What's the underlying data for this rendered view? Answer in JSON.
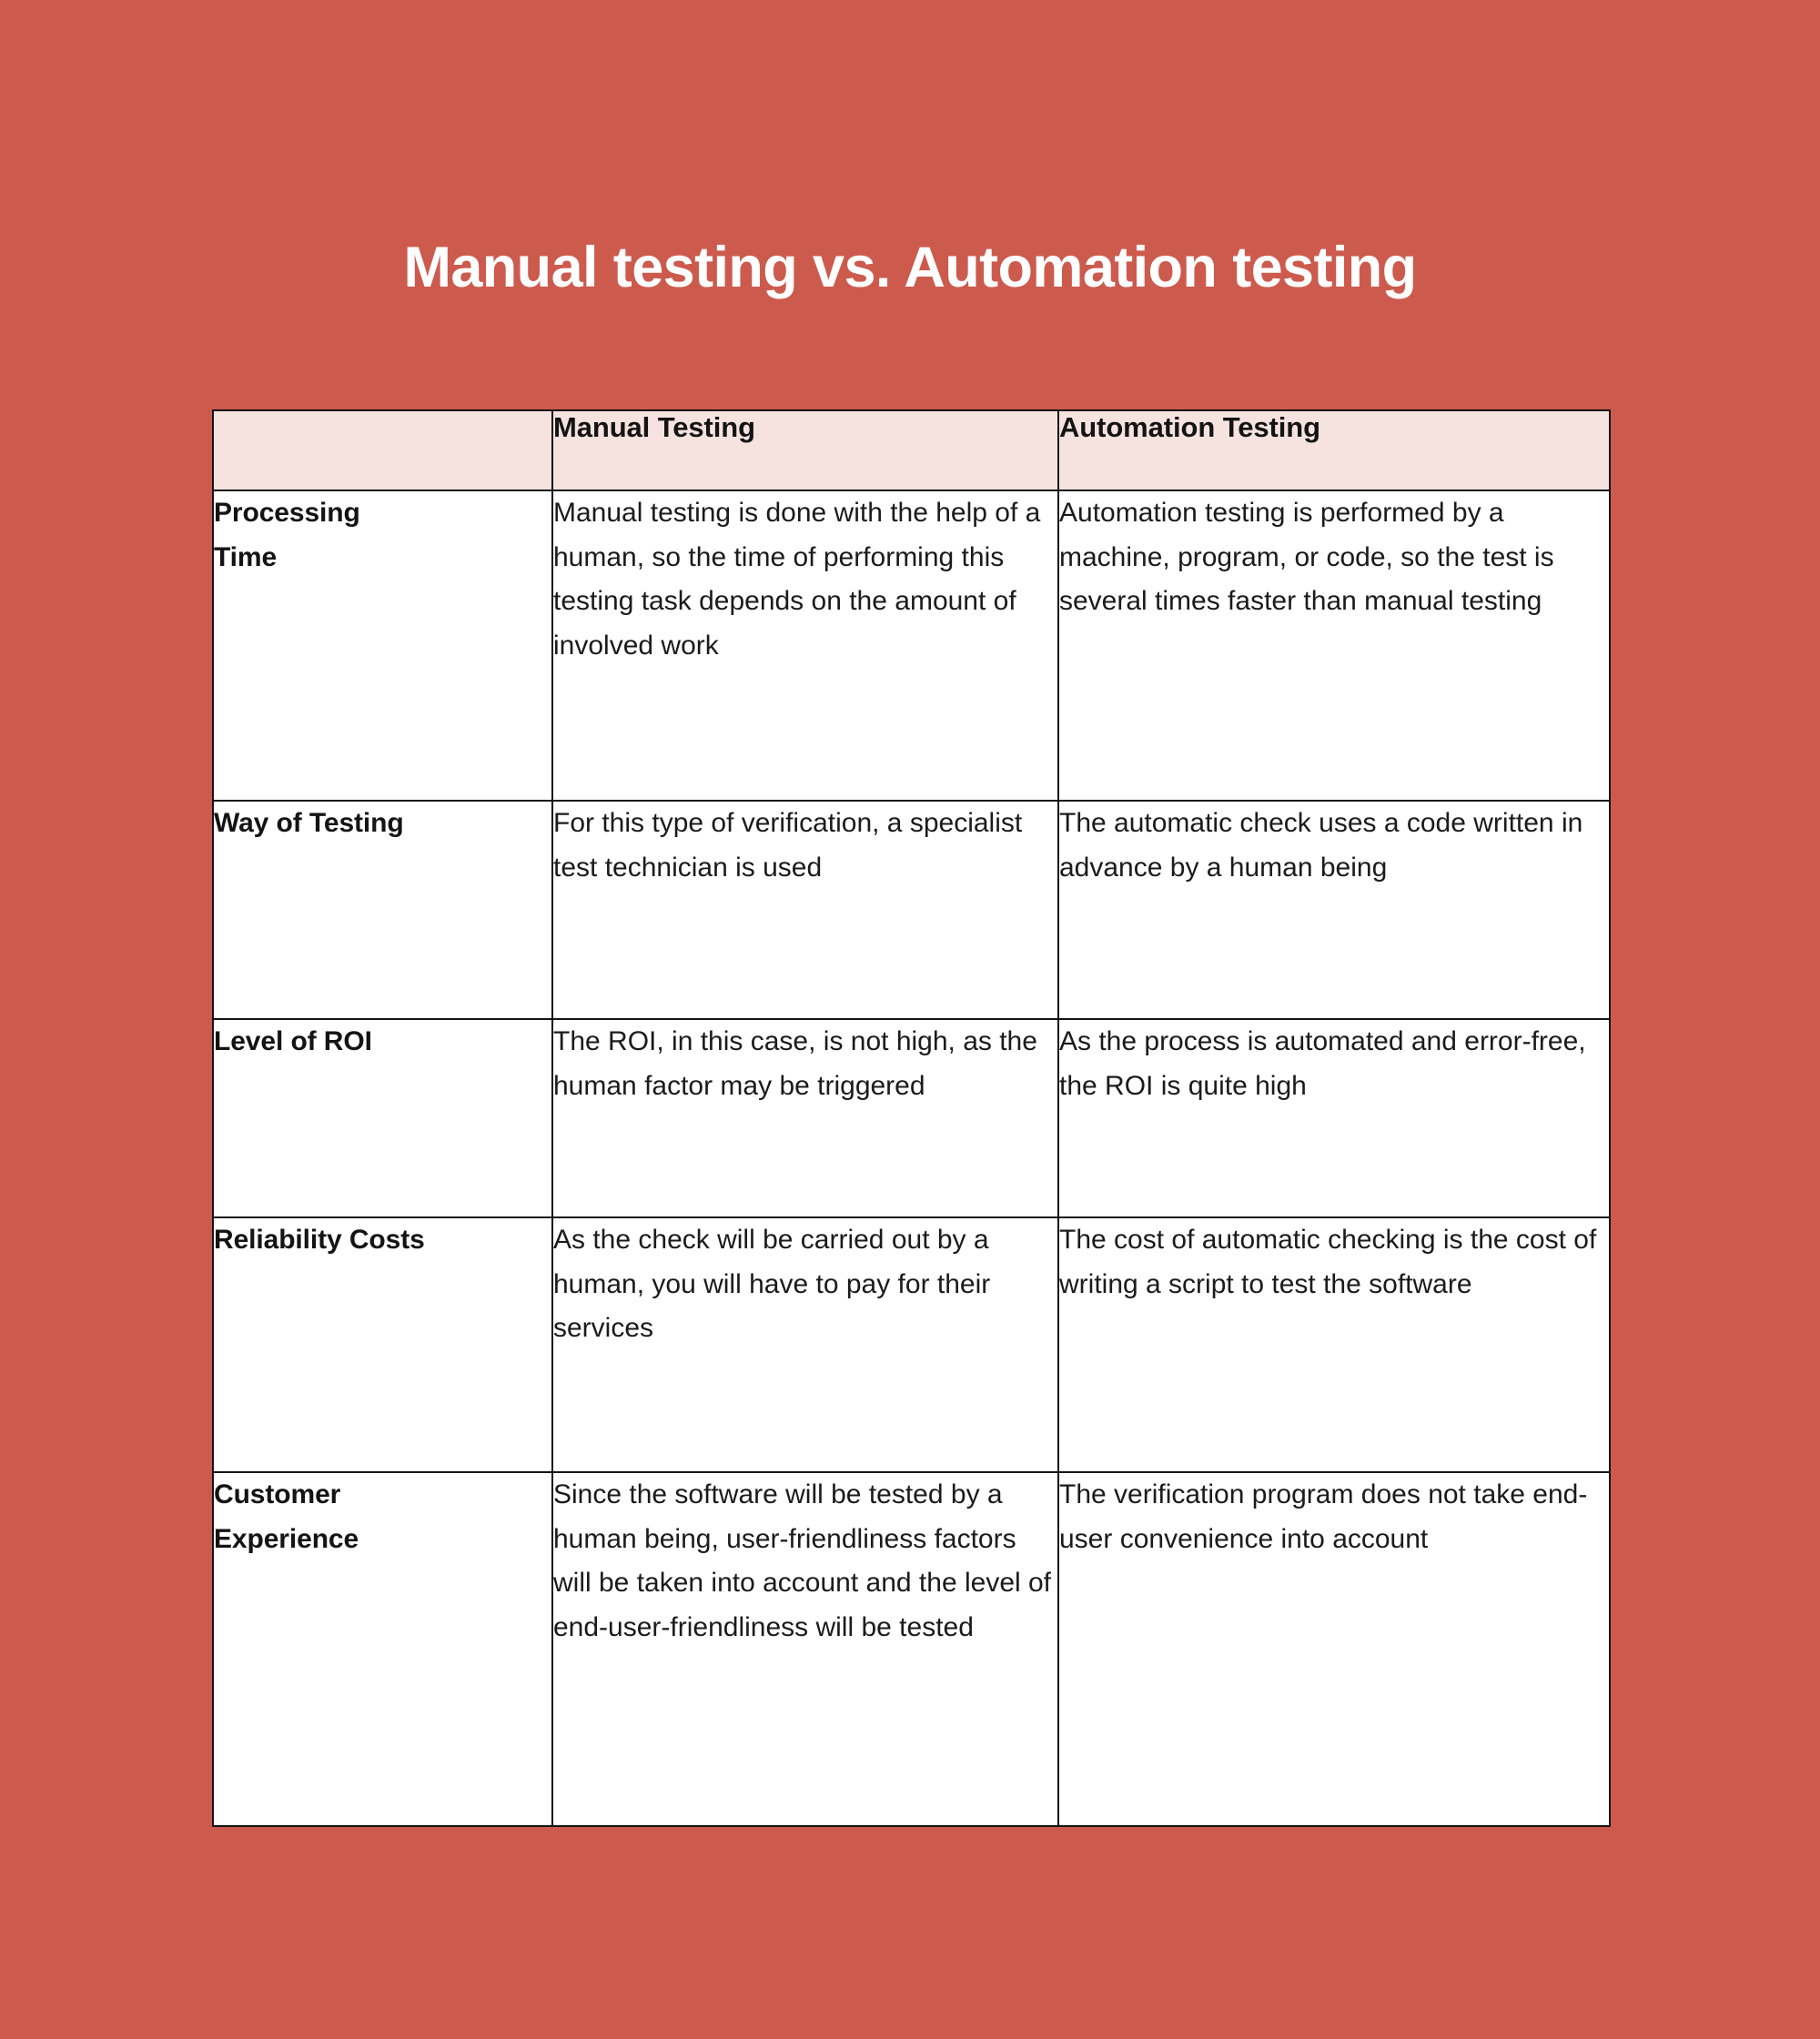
{
  "theme": {
    "background": "#cc5b4e",
    "header_fill": "#f6e3e0",
    "border": "#141414",
    "title_color": "#ffffff",
    "body_text": "#1b1b1b"
  },
  "title": "Manual testing vs. Automation testing",
  "table": {
    "columns": [
      {
        "key": "criteria",
        "label": ""
      },
      {
        "key": "manual",
        "label": "Manual Testing"
      },
      {
        "key": "automation",
        "label": "Automation Testing"
      }
    ],
    "rows": [
      {
        "label": "Processing\nTime",
        "manual": "Manual testing is done with the help of a human, so the time of performing this testing task depends on the amount of involved work",
        "automation": "Automation testing is performed by a machine, program, or code, so the test is several times faster than manual testing"
      },
      {
        "label": "Way of Testing",
        "manual": "For this type of verification, a specialist test technician is used",
        "automation": "The automatic check uses a code written in advance by a human being"
      },
      {
        "label": "Level of ROI",
        "manual": "The ROI, in this case, is not high, as the human factor may be triggered",
        "automation": "As the process is automated and error-free, the ROI is quite high"
      },
      {
        "label": "Reliability Costs",
        "manual": "As the check will be carried out by a human, you will have to pay for their\nservices",
        "automation": "The cost of automatic checking is the cost of writing a script to test the software"
      },
      {
        "label": "Customer\nExperience",
        "manual": "Since the software will be tested by a human being, user-friendliness factors will be taken into account and the level of end-user-friendliness will be tested",
        "automation": "The verification program does not take end-user convenience into account"
      }
    ]
  }
}
